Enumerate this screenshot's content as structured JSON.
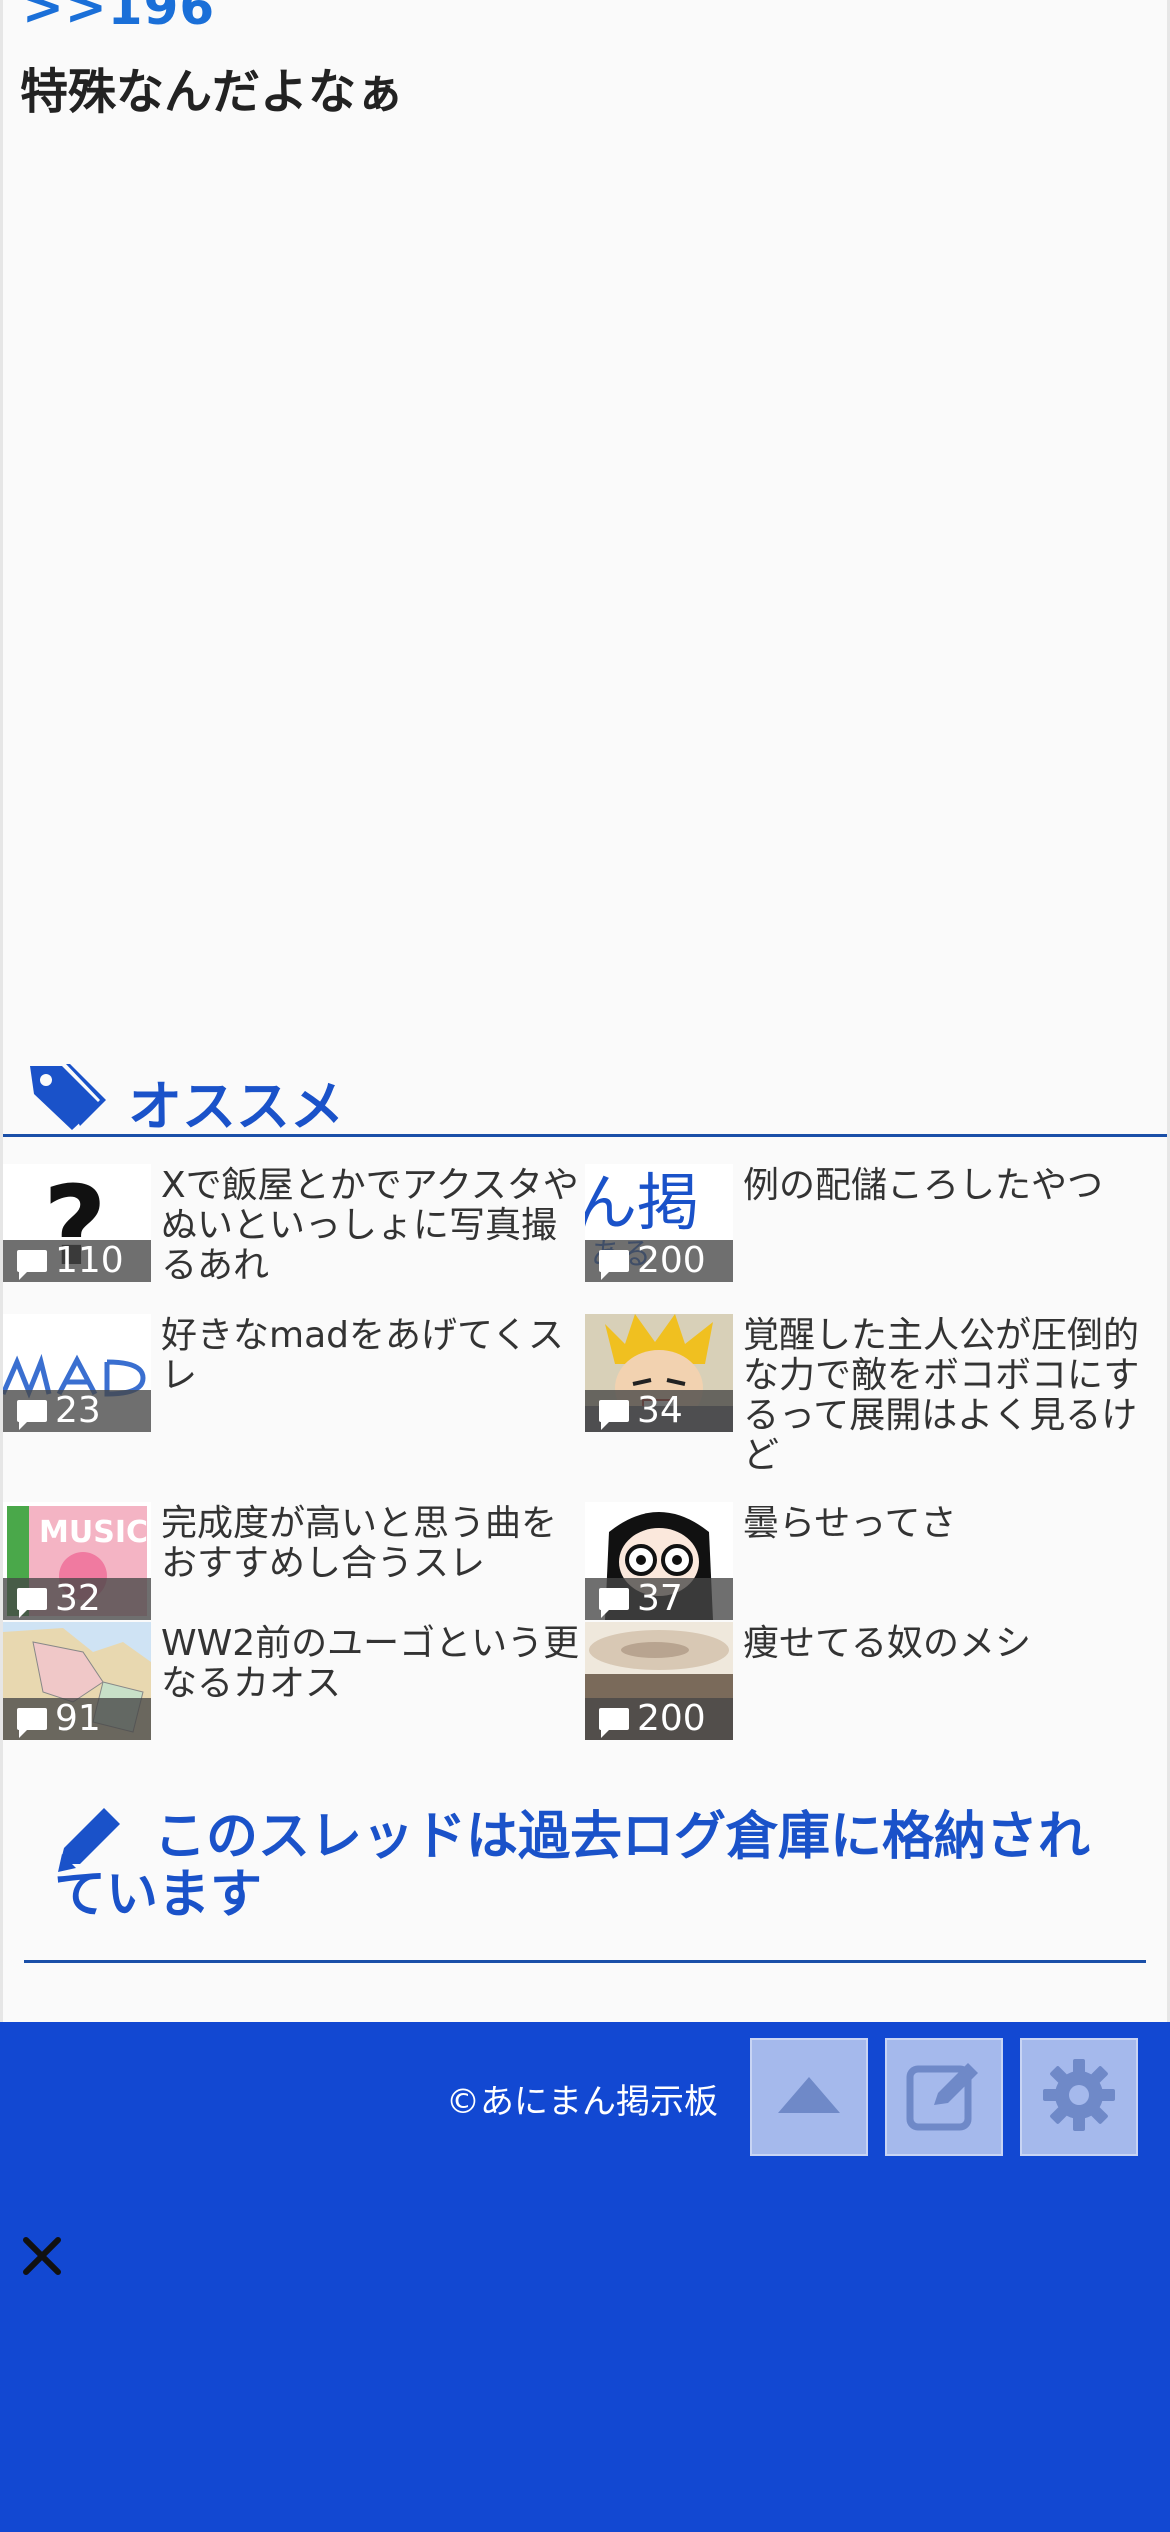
{
  "post": {
    "anchor": ">>196",
    "body": "特殊なんだよなぁ"
  },
  "recommend": {
    "title": "オススメ",
    "items": [
      {
        "title": "Xで飯屋とかでアクスタやぬいといっしょに写真撮るあれ",
        "count": "110"
      },
      {
        "title": "例の配儲ころしたやつ",
        "count": "200"
      },
      {
        "title": "好きなmadをあげてくスレ",
        "count": "23"
      },
      {
        "title": "覚醒した主人公が圧倒的な力で敵をボコボコにするって展開はよく見るけど",
        "count": "34"
      },
      {
        "title": "完成度が高いと思う曲をおすすめし合うスレ",
        "count": "32"
      },
      {
        "title": "曇らせってさ",
        "count": "37"
      },
      {
        "title": "WW2前のユーゴという更なるカオス",
        "count": "91"
      },
      {
        "title": "痩せてる奴のメシ",
        "count": "200"
      }
    ]
  },
  "archive": {
    "text": "このスレッドは過去ログ倉庫に格納されています"
  },
  "footer": {
    "copyright": "©あにまん掲示板"
  },
  "icons": {
    "tag": "tag-icon",
    "pencil": "pencil-icon",
    "comment": "comment-icon",
    "scroll_top": "triangle-up-icon",
    "write": "edit-icon",
    "settings": "gear-icon",
    "close": "close-icon"
  },
  "colors": {
    "accent": "#1a52c9",
    "footer_bg": "#1248d2",
    "anchor": "#1a6fd8"
  }
}
